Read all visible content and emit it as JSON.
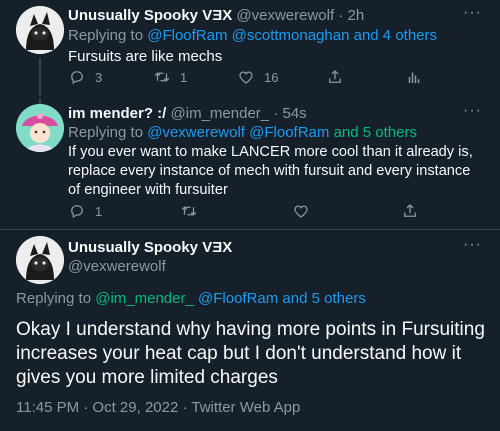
{
  "tweet1": {
    "display_name": "Unusually Spooky VƎX",
    "handle": "@vexwerewolf",
    "separator": "·",
    "time": "2h",
    "replying_prefix": "Replying to",
    "replying_users": "@FloofRam @scottmonaghan",
    "replying_others": "and 4 others",
    "text": "Fursuits are like mechs",
    "replies": "3",
    "retweets": "1",
    "likes": "16"
  },
  "tweet2": {
    "display_name": "im mender? :/",
    "handle": "@im_mender_",
    "separator": "·",
    "time": "54s",
    "replying_prefix": "Replying to",
    "replying_users": "@vexwerewolf @FloofRam",
    "replying_others": "and 5 others",
    "text": "If you ever want to make LANCER more cool than it already is, replace every instance of mech with fursuit and every instance of engineer with fursuiter",
    "replies": "1"
  },
  "tweet3": {
    "display_name": "Unusually Spooky VƎX",
    "handle": "@vexwerewolf",
    "replying_prefix": "Replying to",
    "replying_user1": "@im_mender_",
    "replying_user2": "@FloofRam",
    "replying_others": "and 5 others",
    "text": "Okay I understand why having more points in Fursuiting increases your heat cap but I don't understand how it gives you more limited charges",
    "timestamp": "11:45 PM · Oct 29, 2022 · Twitter Web App"
  },
  "more_label": "···",
  "colors": {
    "background": "#15202b",
    "accent": "#1d9bf0",
    "muted": "#8b98a5",
    "green": "#00ba7c",
    "divider": "#38444d"
  },
  "icons": [
    "reply-icon",
    "retweet-icon",
    "like-icon",
    "share-icon",
    "analytics-icon",
    "more-icon"
  ]
}
